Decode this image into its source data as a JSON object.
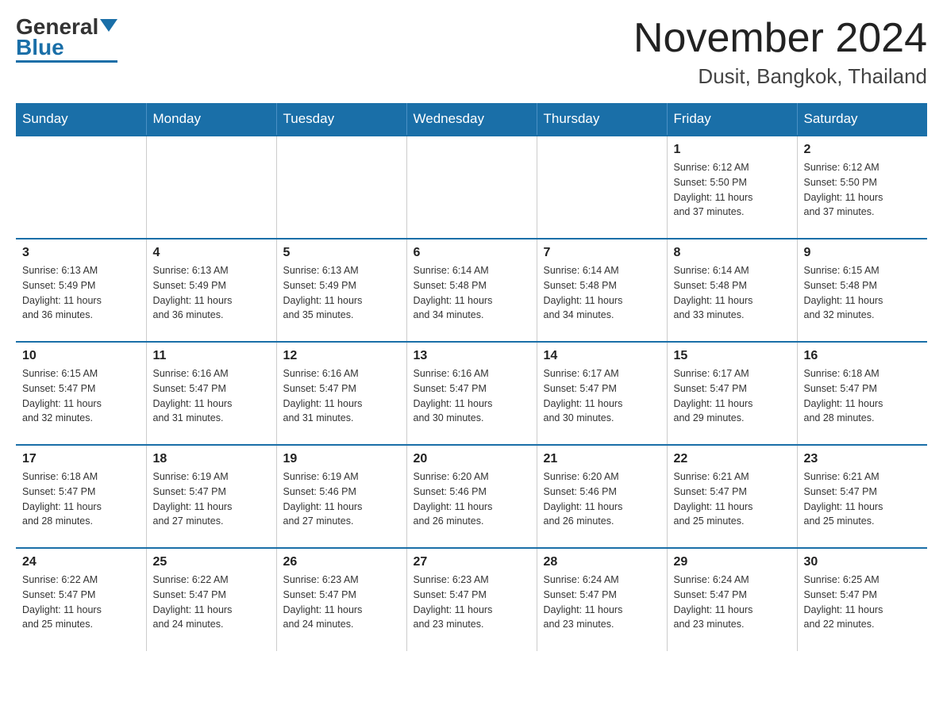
{
  "logo": {
    "general": "General",
    "blue": "Blue"
  },
  "title": {
    "month_year": "November 2024",
    "location": "Dusit, Bangkok, Thailand"
  },
  "weekdays": [
    "Sunday",
    "Monday",
    "Tuesday",
    "Wednesday",
    "Thursday",
    "Friday",
    "Saturday"
  ],
  "weeks": [
    [
      {
        "day": "",
        "info": ""
      },
      {
        "day": "",
        "info": ""
      },
      {
        "day": "",
        "info": ""
      },
      {
        "day": "",
        "info": ""
      },
      {
        "day": "",
        "info": ""
      },
      {
        "day": "1",
        "info": "Sunrise: 6:12 AM\nSunset: 5:50 PM\nDaylight: 11 hours\nand 37 minutes."
      },
      {
        "day": "2",
        "info": "Sunrise: 6:12 AM\nSunset: 5:50 PM\nDaylight: 11 hours\nand 37 minutes."
      }
    ],
    [
      {
        "day": "3",
        "info": "Sunrise: 6:13 AM\nSunset: 5:49 PM\nDaylight: 11 hours\nand 36 minutes."
      },
      {
        "day": "4",
        "info": "Sunrise: 6:13 AM\nSunset: 5:49 PM\nDaylight: 11 hours\nand 36 minutes."
      },
      {
        "day": "5",
        "info": "Sunrise: 6:13 AM\nSunset: 5:49 PM\nDaylight: 11 hours\nand 35 minutes."
      },
      {
        "day": "6",
        "info": "Sunrise: 6:14 AM\nSunset: 5:48 PM\nDaylight: 11 hours\nand 34 minutes."
      },
      {
        "day": "7",
        "info": "Sunrise: 6:14 AM\nSunset: 5:48 PM\nDaylight: 11 hours\nand 34 minutes."
      },
      {
        "day": "8",
        "info": "Sunrise: 6:14 AM\nSunset: 5:48 PM\nDaylight: 11 hours\nand 33 minutes."
      },
      {
        "day": "9",
        "info": "Sunrise: 6:15 AM\nSunset: 5:48 PM\nDaylight: 11 hours\nand 32 minutes."
      }
    ],
    [
      {
        "day": "10",
        "info": "Sunrise: 6:15 AM\nSunset: 5:47 PM\nDaylight: 11 hours\nand 32 minutes."
      },
      {
        "day": "11",
        "info": "Sunrise: 6:16 AM\nSunset: 5:47 PM\nDaylight: 11 hours\nand 31 minutes."
      },
      {
        "day": "12",
        "info": "Sunrise: 6:16 AM\nSunset: 5:47 PM\nDaylight: 11 hours\nand 31 minutes."
      },
      {
        "day": "13",
        "info": "Sunrise: 6:16 AM\nSunset: 5:47 PM\nDaylight: 11 hours\nand 30 minutes."
      },
      {
        "day": "14",
        "info": "Sunrise: 6:17 AM\nSunset: 5:47 PM\nDaylight: 11 hours\nand 30 minutes."
      },
      {
        "day": "15",
        "info": "Sunrise: 6:17 AM\nSunset: 5:47 PM\nDaylight: 11 hours\nand 29 minutes."
      },
      {
        "day": "16",
        "info": "Sunrise: 6:18 AM\nSunset: 5:47 PM\nDaylight: 11 hours\nand 28 minutes."
      }
    ],
    [
      {
        "day": "17",
        "info": "Sunrise: 6:18 AM\nSunset: 5:47 PM\nDaylight: 11 hours\nand 28 minutes."
      },
      {
        "day": "18",
        "info": "Sunrise: 6:19 AM\nSunset: 5:47 PM\nDaylight: 11 hours\nand 27 minutes."
      },
      {
        "day": "19",
        "info": "Sunrise: 6:19 AM\nSunset: 5:46 PM\nDaylight: 11 hours\nand 27 minutes."
      },
      {
        "day": "20",
        "info": "Sunrise: 6:20 AM\nSunset: 5:46 PM\nDaylight: 11 hours\nand 26 minutes."
      },
      {
        "day": "21",
        "info": "Sunrise: 6:20 AM\nSunset: 5:46 PM\nDaylight: 11 hours\nand 26 minutes."
      },
      {
        "day": "22",
        "info": "Sunrise: 6:21 AM\nSunset: 5:47 PM\nDaylight: 11 hours\nand 25 minutes."
      },
      {
        "day": "23",
        "info": "Sunrise: 6:21 AM\nSunset: 5:47 PM\nDaylight: 11 hours\nand 25 minutes."
      }
    ],
    [
      {
        "day": "24",
        "info": "Sunrise: 6:22 AM\nSunset: 5:47 PM\nDaylight: 11 hours\nand 25 minutes."
      },
      {
        "day": "25",
        "info": "Sunrise: 6:22 AM\nSunset: 5:47 PM\nDaylight: 11 hours\nand 24 minutes."
      },
      {
        "day": "26",
        "info": "Sunrise: 6:23 AM\nSunset: 5:47 PM\nDaylight: 11 hours\nand 24 minutes."
      },
      {
        "day": "27",
        "info": "Sunrise: 6:23 AM\nSunset: 5:47 PM\nDaylight: 11 hours\nand 23 minutes."
      },
      {
        "day": "28",
        "info": "Sunrise: 6:24 AM\nSunset: 5:47 PM\nDaylight: 11 hours\nand 23 minutes."
      },
      {
        "day": "29",
        "info": "Sunrise: 6:24 AM\nSunset: 5:47 PM\nDaylight: 11 hours\nand 23 minutes."
      },
      {
        "day": "30",
        "info": "Sunrise: 6:25 AM\nSunset: 5:47 PM\nDaylight: 11 hours\nand 22 minutes."
      }
    ]
  ]
}
